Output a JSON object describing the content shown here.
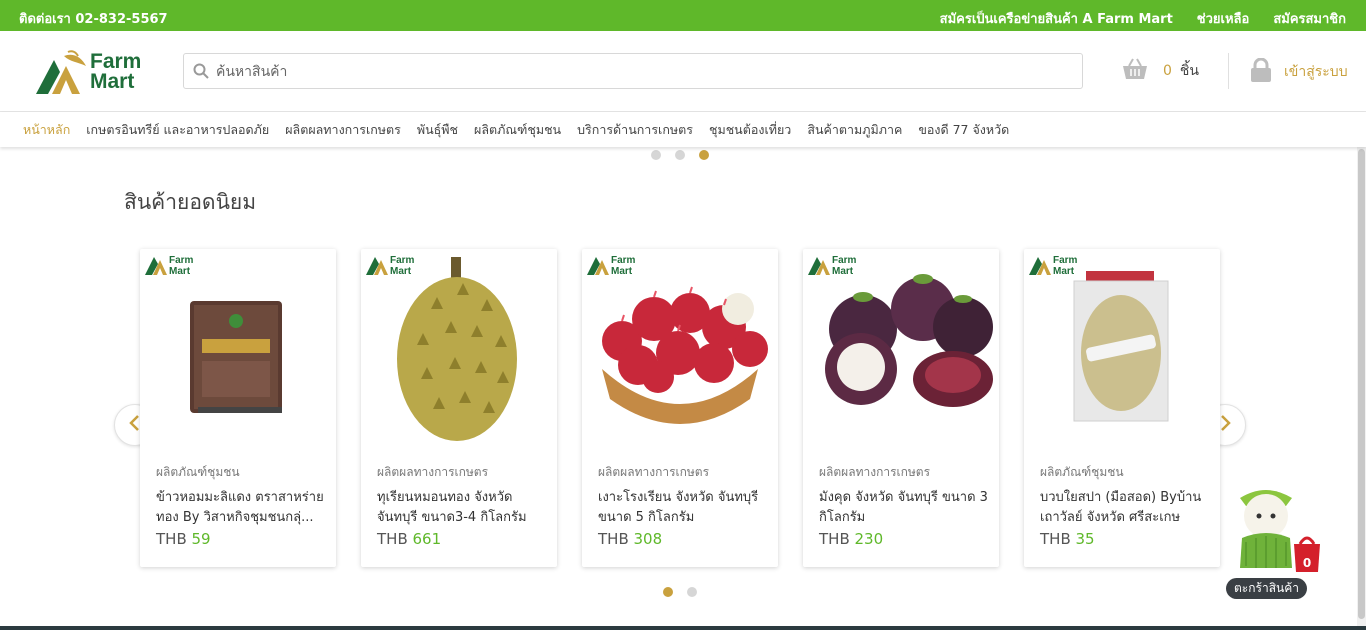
{
  "topbar": {
    "contact": "ติดต่อเรา 02-832-5567",
    "links": [
      "สมัครเป็นเครือข่ายสินค้า A Farm Mart",
      "ช่วยเหลือ",
      "สมัครสมาชิก"
    ]
  },
  "header": {
    "logo_line1": "Farm",
    "logo_line2": "Mart",
    "search_placeholder": "ค้นหาสินค้า",
    "cart_count": "0",
    "cart_unit": "ชิ้น",
    "login_label": "เข้าสู่ระบบ"
  },
  "nav": {
    "items": [
      "หน้าหลัก",
      "เกษตรอินทรีย์ และอาหารปลอดภัย",
      "ผลิตผลทางการเกษตร",
      "พันธุ์พืช",
      "ผลิตภัณฑ์ชุมชน",
      "บริการด้านการเกษตร",
      "ชุมชนต้องเที่ยว",
      "สินค้าตามภูมิภาค",
      "ของดี 77 จังหวัด"
    ],
    "active_index": 0
  },
  "banner_dots": {
    "count": 3,
    "active": 2
  },
  "section": {
    "title": "สินค้ายอดนิยม"
  },
  "badge": {
    "line1": "Farm",
    "line2": "Mart"
  },
  "products": [
    {
      "category": "ผลิตภัณฑ์ชุมชน",
      "name": "ข้าวหอมมะลิแดง ตราสาหร่ายทอง By วิสาหกิจชุมชนกลุ่...",
      "currency": "THB",
      "price": "59",
      "image": "rice-bag"
    },
    {
      "category": "ผลิตผลทางการเกษตร",
      "name": "ทุเรียนหมอนทอง จังหวัดจันทบุรี ขนาด3-4 กิโลกรัม",
      "currency": "THB",
      "price": "661",
      "image": "durian"
    },
    {
      "category": "ผลิตผลทางการเกษตร",
      "name": "เงาะโรงเรียน จังหวัด จันทบุรี ขนาด 5 กิโลกรัม",
      "currency": "THB",
      "price": "308",
      "image": "rambutan"
    },
    {
      "category": "ผลิตผลทางการเกษตร",
      "name": "มังคุด จังหวัด จันทบุรี ขนาด 3 กิโลกรัม",
      "currency": "THB",
      "price": "230",
      "image": "mangosteen"
    },
    {
      "category": "ผลิตภัณฑ์ชุมชน",
      "name": "บวบใยสปา (มือสอด) Byบ้านเถาวัลย์ จังหวัด ศรีสะเกษ",
      "currency": "THB",
      "price": "35",
      "image": "loofah"
    }
  ],
  "carousel_dots": {
    "count": 2,
    "active": 0
  },
  "mascot": {
    "cart_badge": "0",
    "label": "ตะกร้าสินค้า"
  },
  "colors": {
    "brand_green": "#5fb82a",
    "accent_gold": "#c9a13e",
    "logo_green": "#1f6e3a"
  }
}
